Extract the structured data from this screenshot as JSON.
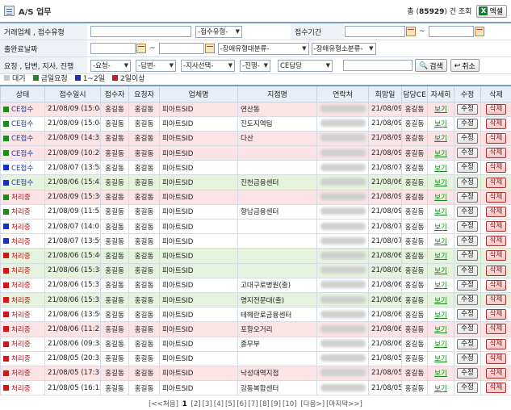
{
  "header": {
    "title": "A/S 업무",
    "count_prefix": "총 (",
    "count_value": "85929",
    "count_suffix": ") 건 조회",
    "excel_label": "엑셀"
  },
  "search": {
    "row1": {
      "label": "거래업체 , 접수유형",
      "type_select": "-접수유형-",
      "period_label": "접수기간",
      "tilde": "~"
    },
    "row2": {
      "label": "출완료날짜",
      "tilde": "~",
      "cat1_select": "-장애유형대분류-",
      "cat2_select": "-장애유형소분류-"
    },
    "row3": {
      "label": "요청 , 답변, 지사, 진행",
      "req_select": "-요청-",
      "ans_select": "-답변-",
      "branch_select": "-지사선택-",
      "prog_select": "-진행-",
      "ce_select": "CE담당",
      "search_label": "검색",
      "cancel_label": "취소"
    }
  },
  "legend": [
    {
      "label": "대기",
      "color": "#c8c8c8"
    },
    {
      "label": "금일요청",
      "color": "#1e8a1e"
    },
    {
      "label": "1~2일",
      "color": "#1a2fc8"
    },
    {
      "label": "2일이상",
      "color": "#d01818"
    }
  ],
  "table": {
    "columns": [
      "상태",
      "접수일시",
      "접수자",
      "요청자",
      "업체명",
      "지점명",
      "연락처",
      "희망일",
      "담당CE",
      "자세히",
      "수정",
      "삭제"
    ],
    "rows": [
      {
        "status": "CE접수",
        "sq": "#1e8a1e",
        "kind": "ce",
        "bg": "pink",
        "date": "21/08/09 (15:04)",
        "receiver": "홍길동",
        "requester": "홍길동",
        "company": "피아트SID",
        "branch": "연산동",
        "hope": "21/08/09",
        "ce": "홍길동"
      },
      {
        "status": "CE접수",
        "sq": "#1e8a1e",
        "kind": "ce",
        "bg": "white",
        "date": "21/08/09 (15:04)",
        "receiver": "홍길동",
        "requester": "홍길동",
        "company": "피아트SID",
        "branch": "진도지역팀",
        "hope": "21/08/09",
        "ce": "홍길동"
      },
      {
        "status": "CE접수",
        "sq": "#1e8a1e",
        "kind": "ce",
        "bg": "pink",
        "date": "21/08/09 (14:35)",
        "receiver": "홍길동",
        "requester": "홍길동",
        "company": "피아트SID",
        "branch": "다산",
        "hope": "21/08/09",
        "ce": "홍길동"
      },
      {
        "status": "CE접수",
        "sq": "#1e8a1e",
        "kind": "ce",
        "bg": "pink",
        "date": "21/08/09 (10:28)",
        "receiver": "홍길동",
        "requester": "홍길동",
        "company": "피아트SID",
        "branch": "",
        "hope": "21/08/09",
        "ce": "홍길동"
      },
      {
        "status": "CE접수",
        "sq": "#1a2fc8",
        "kind": "ce",
        "bg": "white",
        "date": "21/08/07 (13:58)",
        "receiver": "홍길동",
        "requester": "홍길동",
        "company": "피아트SID",
        "branch": "",
        "hope": "21/08/07",
        "ce": "홍길동"
      },
      {
        "status": "CE접수",
        "sq": "#1a2fc8",
        "kind": "ce",
        "bg": "green",
        "date": "21/08/06 (15:42)",
        "receiver": "홍길동",
        "requester": "홍길동",
        "company": "피아트SID",
        "branch": "진천금융센터",
        "hope": "21/08/06",
        "ce": "홍길동"
      },
      {
        "status": "처리중",
        "sq": "#1e8a1e",
        "kind": "proc",
        "bg": "pink",
        "date": "21/08/09 (15:30)",
        "receiver": "홍길동",
        "requester": "홍길동",
        "company": "피아트SID",
        "branch": "",
        "hope": "21/08/09",
        "ce": "홍길동"
      },
      {
        "status": "처리중",
        "sq": "#1e8a1e",
        "kind": "proc",
        "bg": "white",
        "date": "21/08/09 (11:51)",
        "receiver": "홍길동",
        "requester": "홍길동",
        "company": "피아트SID",
        "branch": "향남금융센터",
        "hope": "21/08/09",
        "ce": "홍길동"
      },
      {
        "status": "처리중",
        "sq": "#1a2fc8",
        "kind": "proc",
        "bg": "white",
        "date": "21/08/07 (14:01)",
        "receiver": "홍길동",
        "requester": "홍길동",
        "company": "피아트SID",
        "branch": "",
        "hope": "21/08/07",
        "ce": "홍길동"
      },
      {
        "status": "처리중",
        "sq": "#1a2fc8",
        "kind": "proc",
        "bg": "white",
        "date": "21/08/07 (13:59)",
        "receiver": "홍길동",
        "requester": "홍길동",
        "company": "피아트SID",
        "branch": "",
        "hope": "21/08/07",
        "ce": "홍길동"
      },
      {
        "status": "처리중",
        "sq": "#d01818",
        "kind": "proc",
        "bg": "green",
        "date": "21/08/06 (15:40)",
        "receiver": "홍길동",
        "requester": "홍길동",
        "company": "피아트SID",
        "branch": "",
        "hope": "21/08/06",
        "ce": "홍길동"
      },
      {
        "status": "처리중",
        "sq": "#d01818",
        "kind": "proc",
        "bg": "green",
        "date": "21/08/06 (15:38)",
        "receiver": "홍길동",
        "requester": "홍길동",
        "company": "피아트SID",
        "branch": "",
        "hope": "21/08/06",
        "ce": "홍길동"
      },
      {
        "status": "처리중",
        "sq": "#d01818",
        "kind": "proc",
        "bg": "white",
        "date": "21/08/06 (15:37)",
        "receiver": "홍길동",
        "requester": "홍길동",
        "company": "피아트SID",
        "branch": "고대구로병원(출)",
        "hope": "21/08/06",
        "ce": "홍길동"
      },
      {
        "status": "처리중",
        "sq": "#d01818",
        "kind": "proc",
        "bg": "green",
        "date": "21/08/06 (15:35)",
        "receiver": "홍길동",
        "requester": "홍길동",
        "company": "피아트SID",
        "branch": "명지전문대(출)",
        "hope": "21/08/06",
        "ce": "홍길동"
      },
      {
        "status": "처리중",
        "sq": "#d01818",
        "kind": "proc",
        "bg": "white",
        "date": "21/08/06 (13:56)",
        "receiver": "홍길동",
        "requester": "홍길동",
        "company": "피아트SID",
        "branch": "테헤란로금융센터",
        "hope": "21/08/06",
        "ce": "홍길동"
      },
      {
        "status": "처리중",
        "sq": "#d01818",
        "kind": "proc",
        "bg": "pink",
        "date": "21/08/06 (11:25)",
        "receiver": "홍길동",
        "requester": "홍길동",
        "company": "피아트SID",
        "branch": "포항오거리",
        "hope": "21/08/06",
        "ce": "홍길동"
      },
      {
        "status": "처리중",
        "sq": "#d01818",
        "kind": "proc",
        "bg": "white",
        "date": "21/08/06 (09:38)",
        "receiver": "홍길동",
        "requester": "홍길동",
        "company": "피아트SID",
        "branch": "종무부",
        "hope": "21/08/06",
        "ce": "홍길동"
      },
      {
        "status": "처리중",
        "sq": "#d01818",
        "kind": "proc",
        "bg": "white",
        "date": "21/08/05 (20:33)",
        "receiver": "홍길동",
        "requester": "홍길동",
        "company": "피아트SID",
        "branch": "",
        "hope": "21/08/05",
        "ce": "홍길동"
      },
      {
        "status": "처리중",
        "sq": "#d01818",
        "kind": "proc",
        "bg": "pink",
        "date": "21/08/05 (17:31)",
        "receiver": "홍길동",
        "requester": "홍길동",
        "company": "피아트SID",
        "branch": "낙성대역지점",
        "hope": "21/08/05",
        "ce": "홍길동"
      },
      {
        "status": "처리중",
        "sq": "#d01818",
        "kind": "proc",
        "bg": "white",
        "date": "21/08/05 (16:13)",
        "receiver": "홍길동",
        "requester": "홍길동",
        "company": "피아트SID",
        "branch": "강동복합센터",
        "hope": "21/08/05",
        "ce": "홍길동"
      }
    ],
    "view_label": "보기",
    "edit_label": "수정",
    "delete_label": "삭제"
  },
  "pager": {
    "first": "[<<처음]",
    "current": "1",
    "pages": [
      "[2]",
      "[3]",
      "[4]",
      "[5]",
      "[6]",
      "[7]",
      "[8]",
      "[9]",
      "[10]"
    ],
    "next": "[다음>]",
    "last": "[마지막>>]"
  }
}
